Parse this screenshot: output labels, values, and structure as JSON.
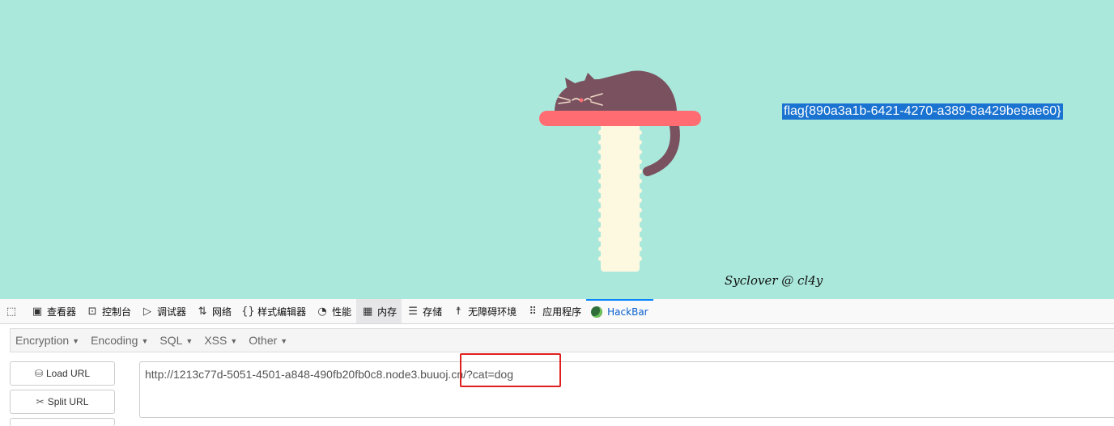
{
  "page": {
    "flag_text": "flag{890a3a1b-6421-4270-a389-8a429be9ae60}",
    "credit": "Syclover @ cl4y"
  },
  "colors": {
    "background": "#aae8dc",
    "cat": "#7a525f",
    "shelf": "#ff6d73",
    "post": "#fdf8e0",
    "selection": "#1a73d0",
    "highlight_box": "#e02020"
  },
  "devtools": {
    "tabs": [
      {
        "label": "",
        "icon": "pick-element-icon"
      },
      {
        "label": "查看器",
        "icon": "inspector-icon"
      },
      {
        "label": "控制台",
        "icon": "console-icon"
      },
      {
        "label": "调试器",
        "icon": "debugger-icon"
      },
      {
        "label": "网络",
        "icon": "network-icon"
      },
      {
        "label": "样式编辑器",
        "icon": "style-editor-icon"
      },
      {
        "label": "性能",
        "icon": "performance-icon"
      },
      {
        "label": "内存",
        "icon": "memory-icon"
      },
      {
        "label": "存储",
        "icon": "storage-icon"
      },
      {
        "label": "无障碍环境",
        "icon": "accessibility-icon"
      },
      {
        "label": "应用程序",
        "icon": "application-icon"
      },
      {
        "label": "HackBar",
        "icon": "hackbar-icon"
      }
    ]
  },
  "hackbar": {
    "menu": [
      "Encryption",
      "Encoding",
      "SQL",
      "XSS",
      "Other"
    ],
    "load_url": "Load URL",
    "split_url": "Split URL",
    "url": "http://1213c77d-5051-4501-a848-490fb20fb0c8.node3.buuoj.cn/?cat=dog"
  }
}
